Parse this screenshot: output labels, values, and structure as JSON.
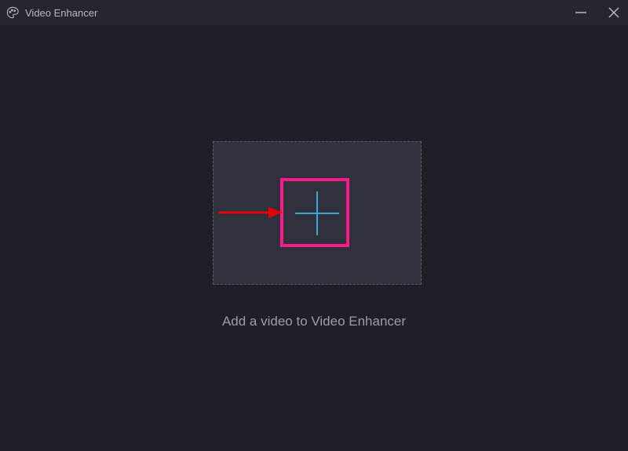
{
  "titlebar": {
    "app_title": "Video Enhancer"
  },
  "main": {
    "hint_text": "Add a video to Video Enhancer"
  }
}
